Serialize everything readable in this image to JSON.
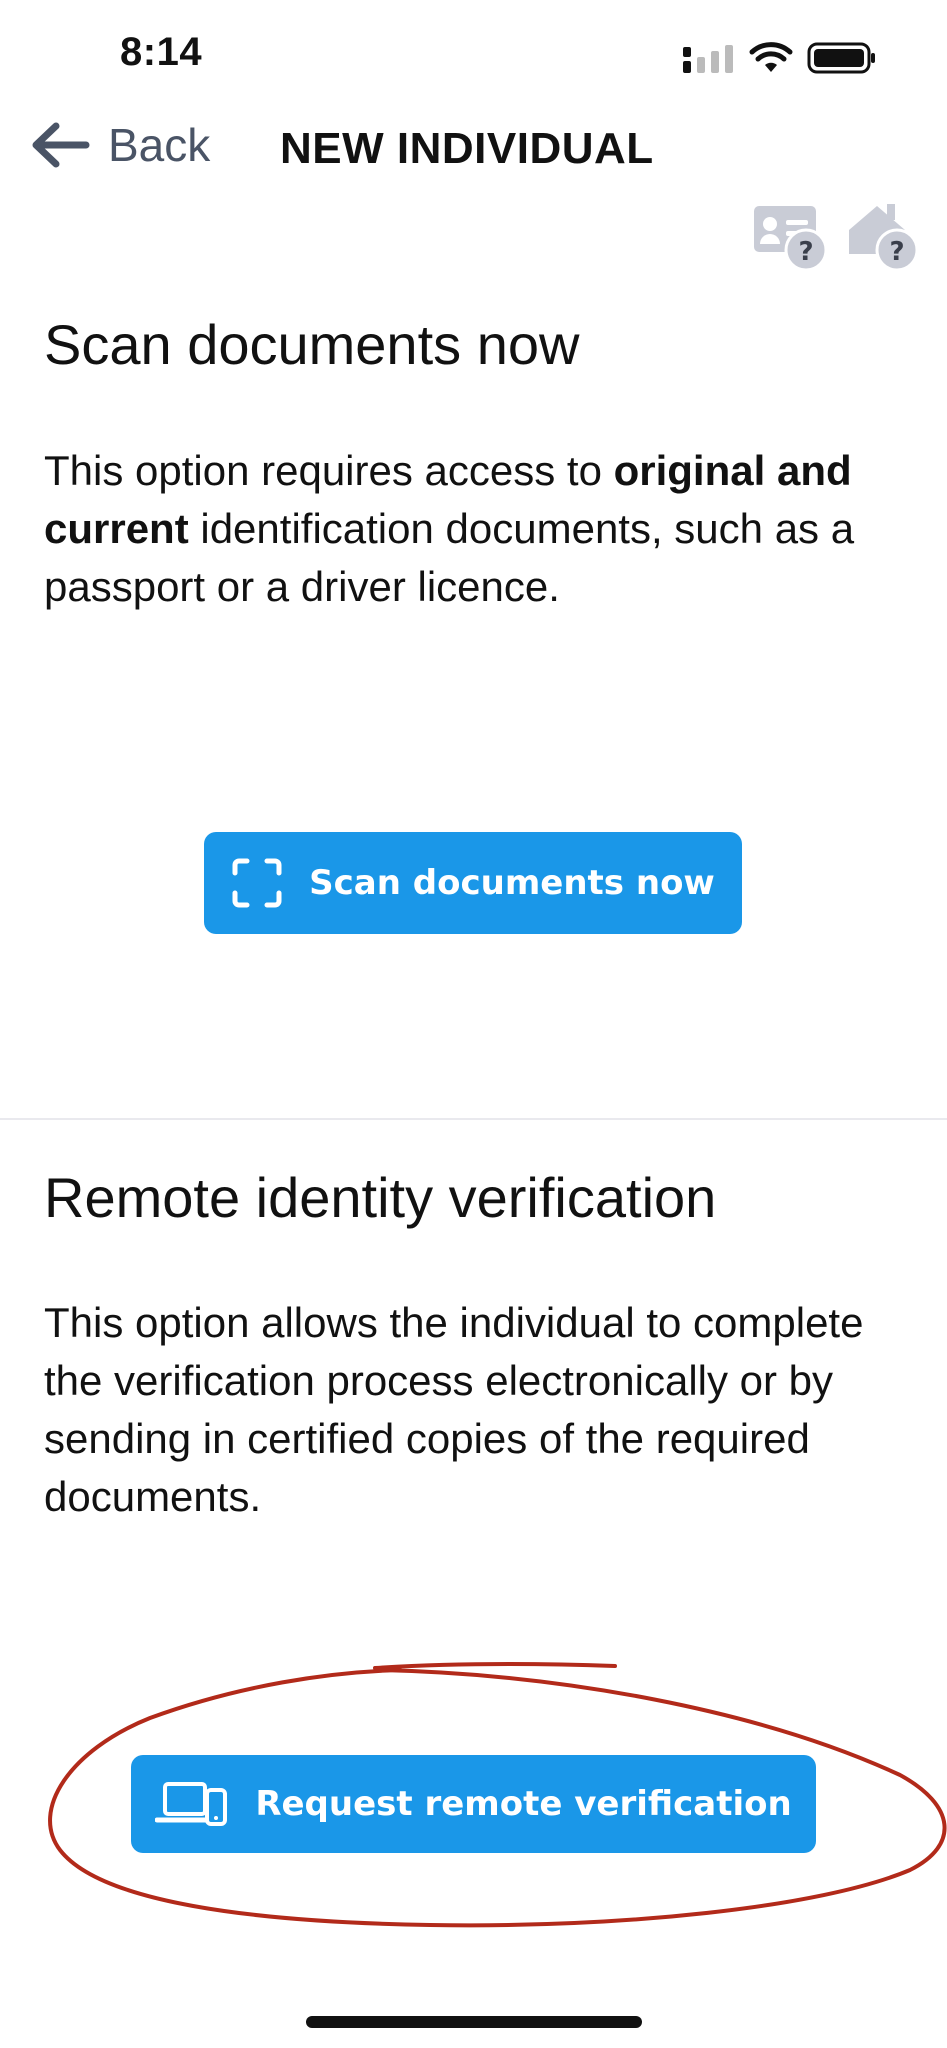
{
  "status_bar": {
    "time": "8:14"
  },
  "nav": {
    "back_label": "Back",
    "title": "NEW INDIVIDUAL"
  },
  "help_icons": [
    "id-card-help-icon",
    "home-help-icon"
  ],
  "scan_section": {
    "title": "Scan documents now",
    "desc_part1": "This option requires access to ",
    "desc_bold": "original and current",
    "desc_part2": " identification documents, such as a passport or a driver licence.",
    "button_label": "Scan documents now"
  },
  "remote_section": {
    "title": "Remote identity verification",
    "desc": "This option allows the individual to complete the verification process electronically or by sending in certified copies of the required documents.",
    "button_label": "Request remote verification"
  },
  "colors": {
    "accent": "#1a97e8",
    "annotation": "#b22a1a",
    "back": "#4a5466"
  }
}
